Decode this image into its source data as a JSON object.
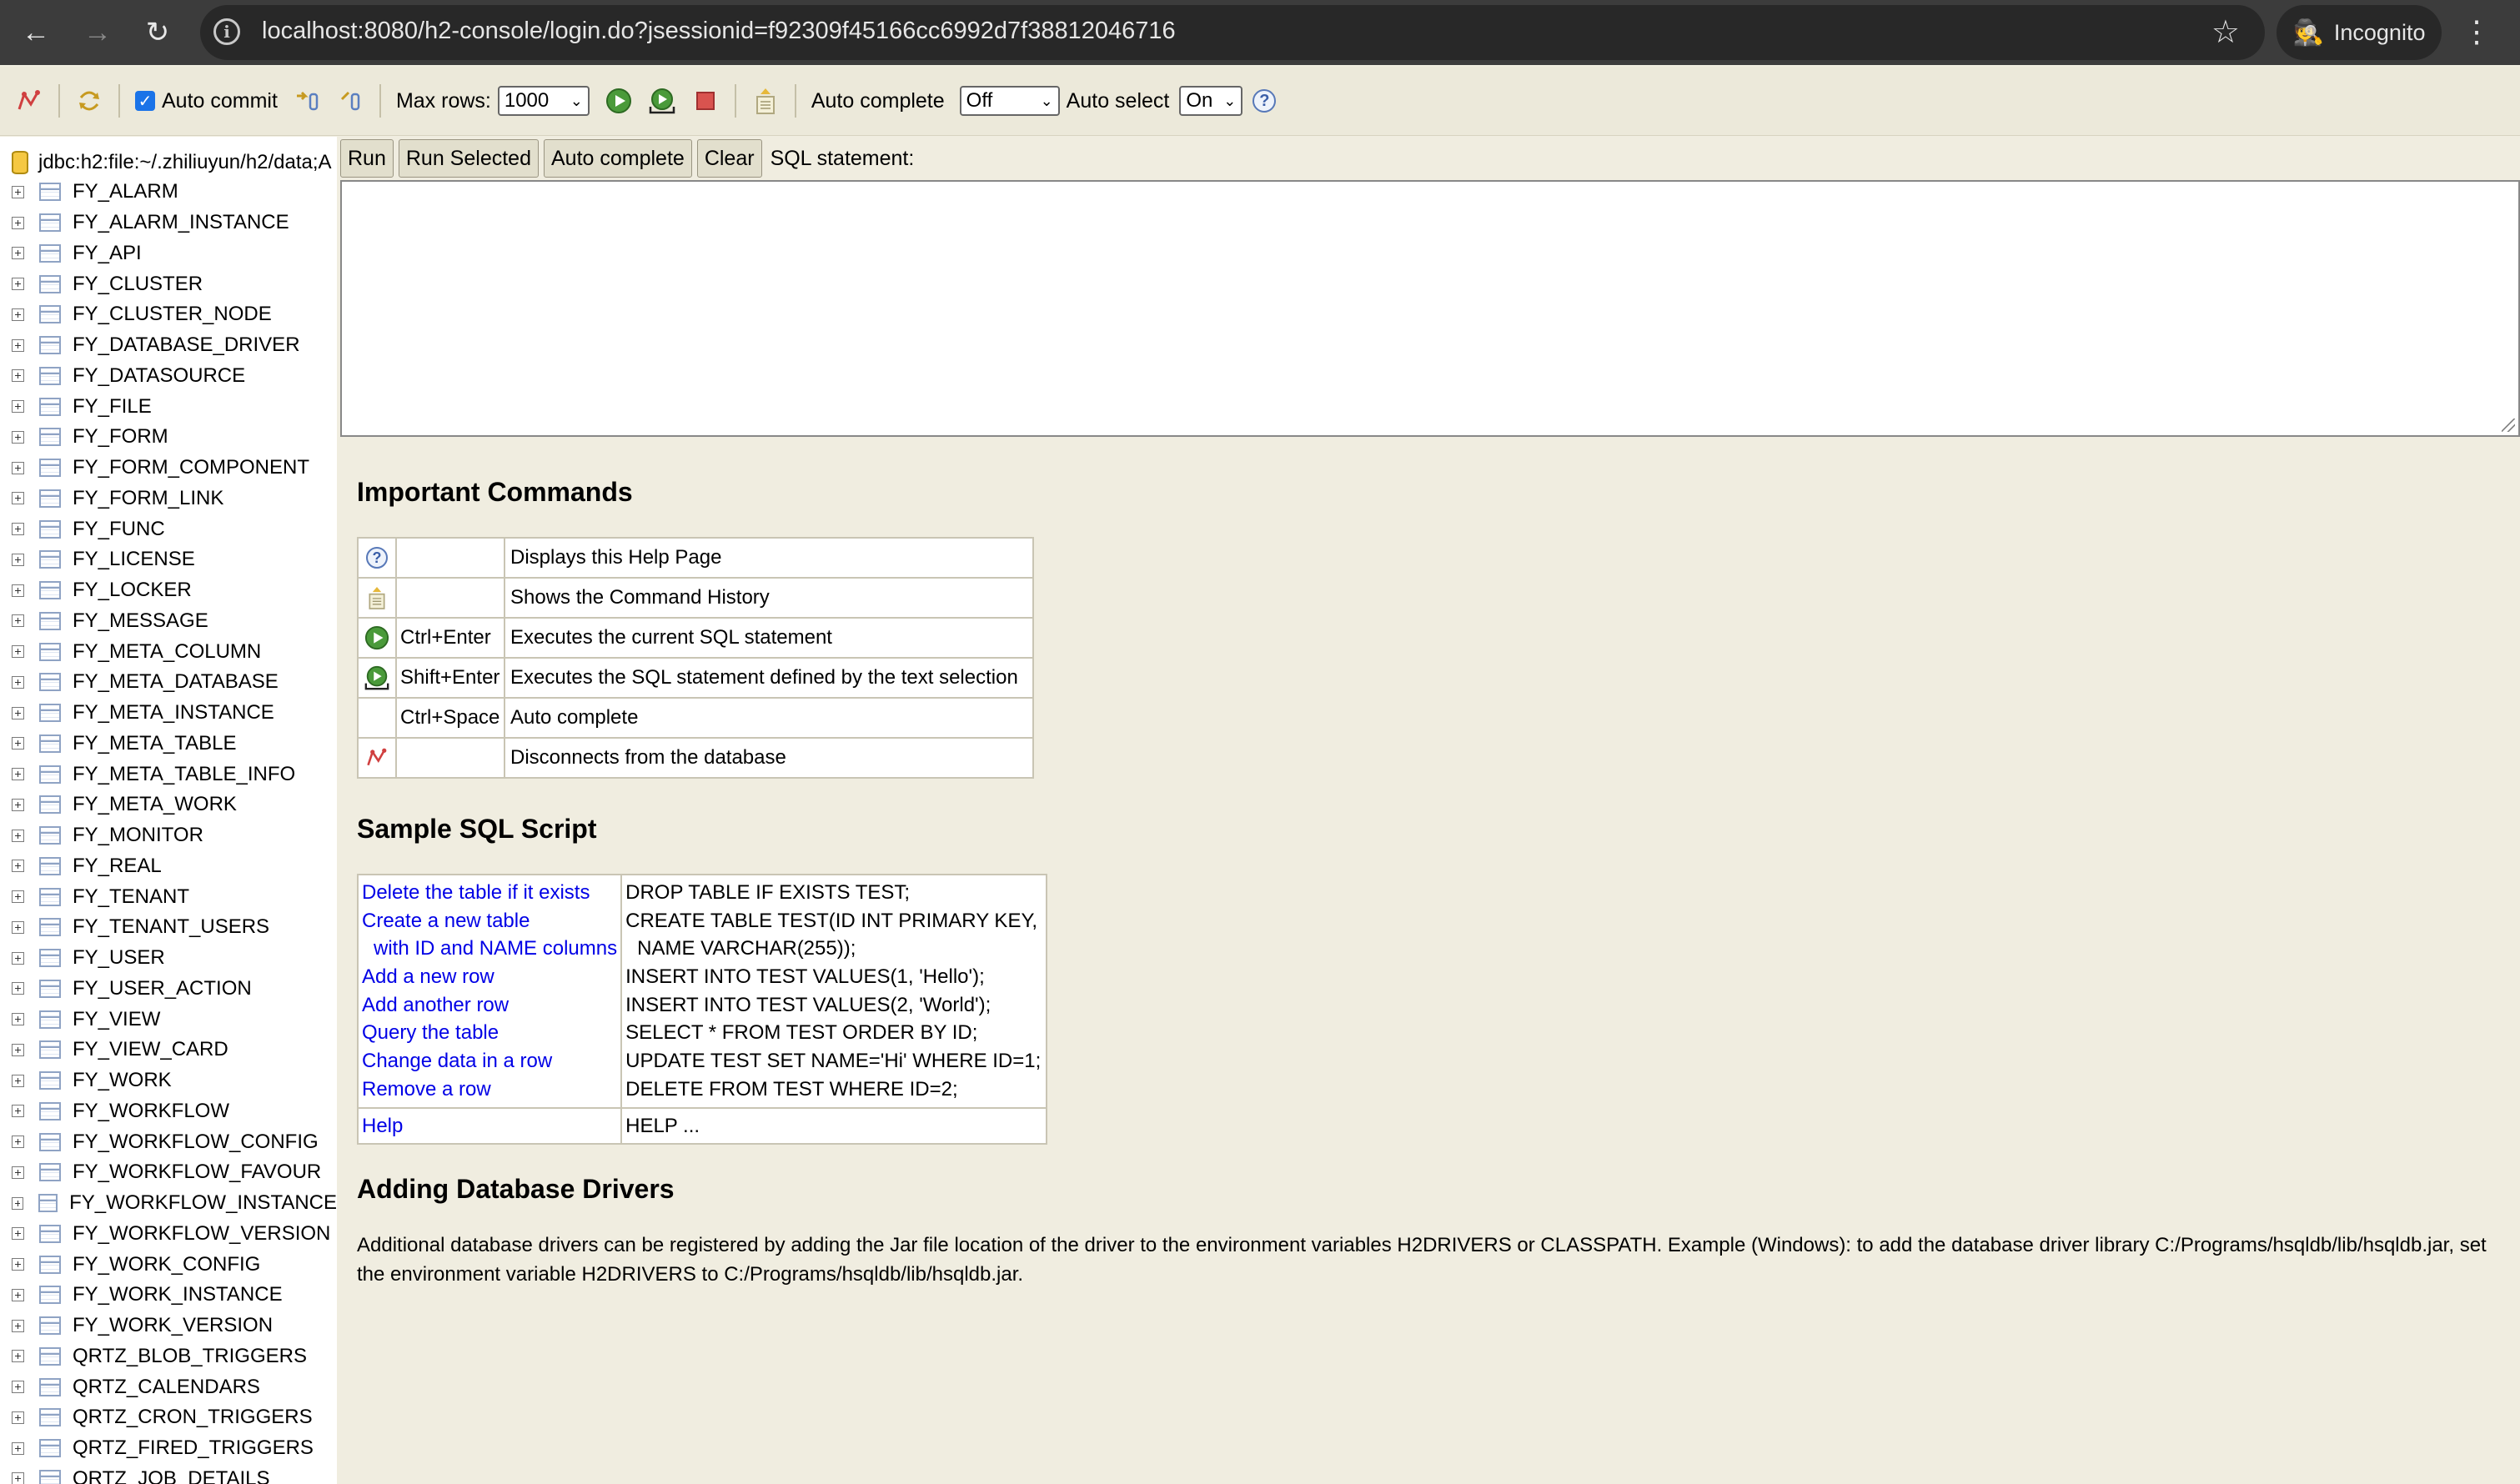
{
  "browser": {
    "url": "localhost:8080/h2-console/login.do?jsessionid=f92309f45166cc6992d7f38812046716",
    "profile_label": "Incognito"
  },
  "toolbar": {
    "auto_commit_label": "Auto commit",
    "auto_commit_checked": true,
    "max_rows_label": "Max rows:",
    "max_rows_value": "1000",
    "auto_complete_label": "Auto complete",
    "auto_complete_value": "Off",
    "auto_select_label": "Auto select",
    "auto_select_value": "On"
  },
  "tree": {
    "connection": "jdbc:h2:file:~/.zhiliuyun/h2/data;A",
    "tables": [
      "FY_ALARM",
      "FY_ALARM_INSTANCE",
      "FY_API",
      "FY_CLUSTER",
      "FY_CLUSTER_NODE",
      "FY_DATABASE_DRIVER",
      "FY_DATASOURCE",
      "FY_FILE",
      "FY_FORM",
      "FY_FORM_COMPONENT",
      "FY_FORM_LINK",
      "FY_FUNC",
      "FY_LICENSE",
      "FY_LOCKER",
      "FY_MESSAGE",
      "FY_META_COLUMN",
      "FY_META_DATABASE",
      "FY_META_INSTANCE",
      "FY_META_TABLE",
      "FY_META_TABLE_INFO",
      "FY_META_WORK",
      "FY_MONITOR",
      "FY_REAL",
      "FY_TENANT",
      "FY_TENANT_USERS",
      "FY_USER",
      "FY_USER_ACTION",
      "FY_VIEW",
      "FY_VIEW_CARD",
      "FY_WORK",
      "FY_WORKFLOW",
      "FY_WORKFLOW_CONFIG",
      "FY_WORKFLOW_FAVOUR",
      "FY_WORKFLOW_INSTANCE",
      "FY_WORKFLOW_VERSION",
      "FY_WORK_CONFIG",
      "FY_WORK_INSTANCE",
      "FY_WORK_VERSION",
      "QRTZ_BLOB_TRIGGERS",
      "QRTZ_CALENDARS",
      "QRTZ_CRON_TRIGGERS",
      "QRTZ_FIRED_TRIGGERS",
      "QRTZ_JOB_DETAILS"
    ]
  },
  "query": {
    "run": "Run",
    "run_selected": "Run Selected",
    "auto_complete": "Auto complete",
    "clear": "Clear",
    "sql_label": "SQL statement:"
  },
  "help": {
    "important_title": "Important Commands",
    "commands": [
      {
        "icon": "help-icon",
        "key": "",
        "desc": "Displays this Help Page"
      },
      {
        "icon": "history-icon",
        "key": "",
        "desc": "Shows the Command History"
      },
      {
        "icon": "run-icon",
        "key": "Ctrl+Enter",
        "desc": "Executes the current SQL statement"
      },
      {
        "icon": "run-selected-icon",
        "key": "Shift+Enter",
        "desc": "Executes the SQL statement defined by the text selection"
      },
      {
        "icon": "",
        "key": "Ctrl+Space",
        "desc": "Auto complete"
      },
      {
        "icon": "disconnect-icon",
        "key": "",
        "desc": "Disconnects from the database"
      }
    ],
    "sample_title": "Sample SQL Script",
    "sample_links": [
      "Delete the table if it exists",
      "Create a new table",
      "with ID and NAME columns",
      "Add a new row",
      "Add another row",
      "Query the table",
      "Change data in a row",
      "Remove a row"
    ],
    "sample_sql": [
      "DROP TABLE IF EXISTS TEST;",
      "CREATE TABLE TEST(ID INT PRIMARY KEY,",
      "NAME VARCHAR(255));",
      "INSERT INTO TEST VALUES(1, 'Hello');",
      "INSERT INTO TEST VALUES(2, 'World');",
      "SELECT * FROM TEST ORDER BY ID;",
      "UPDATE TEST SET NAME='Hi' WHERE ID=1;",
      "DELETE FROM TEST WHERE ID=2;"
    ],
    "help_link": "Help",
    "help_sql": "HELP ...",
    "drivers_title": "Adding Database Drivers",
    "drivers_text": "Additional database drivers can be registered by adding the Jar file location of the driver to the environment variables H2DRIVERS or CLASSPATH. Example (Windows): to add the database driver library C:/Programs/hsqldb/lib/hsqldb.jar, set the environment variable H2DRIVERS to C:/Programs/hsqldb/lib/hsqldb.jar."
  }
}
